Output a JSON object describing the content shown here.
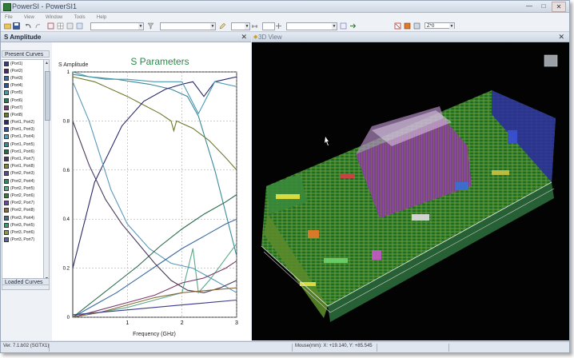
{
  "window": {
    "title": "PowerSI - PowerSI1",
    "close_glyph": "✕"
  },
  "menu": [
    "File",
    "View",
    "Window",
    "Tools",
    "Help"
  ],
  "toolbar": {
    "zoom_label": "Z*0"
  },
  "left_panel": {
    "title": "S Amplitude",
    "close_glyph": "✕",
    "present_curves_label": "Present Curves",
    "loaded_curves_label": "Loaded Curves",
    "curves": [
      {
        "label": "(Port1)",
        "color": "#3a3a8a"
      },
      {
        "label": "(Port2)",
        "color": "#4a2a6a"
      },
      {
        "label": "(Port3)",
        "color": "#3a6aa0"
      },
      {
        "label": "(Port4)",
        "color": "#2a5a8a"
      },
      {
        "label": "(Port5)",
        "color": "#4a9ab0"
      },
      {
        "label": "(Port6)",
        "color": "#2a7a5a"
      },
      {
        "label": "(Port7)",
        "color": "#7a3a6a"
      },
      {
        "label": "(Port8)",
        "color": "#6a7a2a"
      },
      {
        "label": "(Port1, Port2)",
        "color": "#2a2a6a"
      },
      {
        "label": "(Port1, Port3)",
        "color": "#3a4a9a"
      },
      {
        "label": "(Port1, Port4)",
        "color": "#5a9aba"
      },
      {
        "label": "(Port1, Port5)",
        "color": "#3a8a9a"
      },
      {
        "label": "(Port1, Port6)",
        "color": "#2a6a4a"
      },
      {
        "label": "(Port1, Port7)",
        "color": "#4a3a5a"
      },
      {
        "label": "(Port1, Port8)",
        "color": "#7a8a3a"
      },
      {
        "label": "(Port2, Port3)",
        "color": "#5a4a8a"
      },
      {
        "label": "(Port2, Port4)",
        "color": "#2a8a6a"
      },
      {
        "label": "(Port2, Port5)",
        "color": "#5aaa8a"
      },
      {
        "label": "(Port2, Port6)",
        "color": "#3a7a3a"
      },
      {
        "label": "(Port2, Port7)",
        "color": "#6a4a9a"
      },
      {
        "label": "(Port2, Port8)",
        "color": "#8a6a3a"
      },
      {
        "label": "(Port3, Port4)",
        "color": "#4a6a8a"
      },
      {
        "label": "(Port3, Port5)",
        "color": "#3a9a7a"
      },
      {
        "label": "(Port3, Port6)",
        "color": "#8a9a4a"
      },
      {
        "label": "(Port3, Port7)",
        "color": "#5a6a9a"
      }
    ]
  },
  "view3d": {
    "title": "3D View",
    "close_glyph": "✕"
  },
  "status": {
    "version": "Ver. 7.1.b02 (SGTX1)",
    "mouse": "Mouse(mm): X: +19.140, Y: +85.545"
  },
  "chart_data": {
    "type": "line",
    "title": "S Parameters",
    "ylabel": "S Amplitude",
    "xlabel": "Frequency (GHz)",
    "xlim": [
      0,
      3
    ],
    "ylim": [
      0,
      1
    ],
    "xticks": [
      1,
      2,
      3
    ],
    "yticks": [
      0,
      0.2,
      0.4,
      0.6,
      0.8,
      1
    ],
    "grid": true,
    "series": [
      {
        "color": "#3a8a9a",
        "x": [
          0,
          0.3,
          0.8,
          1.4,
          1.8,
          2.1,
          2.3,
          2.6,
          3.0
        ],
        "y": [
          0.99,
          0.98,
          0.97,
          0.95,
          0.93,
          0.9,
          0.82,
          0.6,
          0.25
        ]
      },
      {
        "color": "#6a7a2a",
        "x": [
          0,
          0.4,
          1.0,
          1.6,
          1.8,
          1.85,
          1.9,
          2.2,
          2.5,
          2.8,
          3.0
        ],
        "y": [
          0.98,
          0.96,
          0.9,
          0.83,
          0.8,
          0.76,
          0.8,
          0.77,
          0.72,
          0.65,
          0.6
        ]
      },
      {
        "color": "#2a2a6a",
        "x": [
          0,
          0.4,
          0.9,
          1.3,
          1.7,
          2.0,
          2.2,
          2.4,
          2.6,
          2.8,
          3.0
        ],
        "y": [
          0.2,
          0.55,
          0.78,
          0.88,
          0.93,
          0.95,
          0.96,
          0.9,
          0.96,
          0.97,
          0.98
        ]
      },
      {
        "color": "#5a9aba",
        "x": [
          0,
          0.3,
          0.7,
          1.0,
          1.4,
          1.8,
          2.2,
          2.6,
          3.0
        ],
        "y": [
          0.96,
          0.8,
          0.52,
          0.38,
          0.28,
          0.22,
          0.2,
          0.15,
          0.1
        ]
      },
      {
        "color": "#2a6a4a",
        "x": [
          0,
          0.4,
          0.8,
          1.2,
          1.6,
          2.0,
          2.4,
          2.8,
          3.0
        ],
        "y": [
          0.0,
          0.07,
          0.14,
          0.21,
          0.29,
          0.36,
          0.42,
          0.47,
          0.5
        ]
      },
      {
        "color": "#3a6aa0",
        "x": [
          0,
          0.4,
          0.8,
          1.2,
          1.6,
          2.0,
          2.4,
          2.8,
          3.0
        ],
        "y": [
          0.0,
          0.05,
          0.1,
          0.16,
          0.22,
          0.28,
          0.33,
          0.38,
          0.4
        ]
      },
      {
        "color": "#4a3a5a",
        "x": [
          0,
          0.3,
          0.6,
          0.9,
          1.2,
          1.5,
          1.8,
          2.1,
          2.4,
          2.7,
          3.0
        ],
        "y": [
          0.8,
          0.62,
          0.48,
          0.38,
          0.3,
          0.22,
          0.15,
          0.11,
          0.1,
          0.12,
          0.15
        ]
      },
      {
        "color": "#5aaa8a",
        "x": [
          0,
          0.5,
          1.0,
          1.5,
          2.0,
          2.2,
          2.3,
          2.5,
          3.0
        ],
        "y": [
          0.0,
          0.02,
          0.04,
          0.07,
          0.1,
          0.28,
          0.1,
          0.15,
          0.3
        ]
      },
      {
        "color": "#7a3a6a",
        "x": [
          0,
          0.5,
          1.0,
          1.5,
          1.8,
          2.0,
          2.4,
          2.8,
          3.0
        ],
        "y": [
          0.0,
          0.03,
          0.06,
          0.09,
          0.12,
          0.14,
          0.16,
          0.2,
          0.23
        ]
      },
      {
        "color": "#8a6a3a",
        "x": [
          0,
          0.5,
          1.0,
          1.5,
          2.0,
          2.5,
          3.0
        ],
        "y": [
          0.0,
          0.02,
          0.05,
          0.08,
          0.1,
          0.11,
          0.12
        ]
      },
      {
        "color": "#4a9ab0",
        "x": [
          0,
          0.3,
          0.6,
          1.0,
          1.5,
          2.0,
          2.3,
          2.6,
          3.0
        ],
        "y": [
          1.0,
          0.98,
          0.97,
          0.97,
          0.96,
          0.96,
          0.83,
          0.96,
          0.94
        ]
      },
      {
        "color": "#3a3a8a",
        "x": [
          0,
          0.5,
          1.0,
          1.5,
          2.0,
          2.5,
          3.0
        ],
        "y": [
          0.01,
          0.02,
          0.03,
          0.04,
          0.05,
          0.06,
          0.07
        ]
      }
    ]
  }
}
